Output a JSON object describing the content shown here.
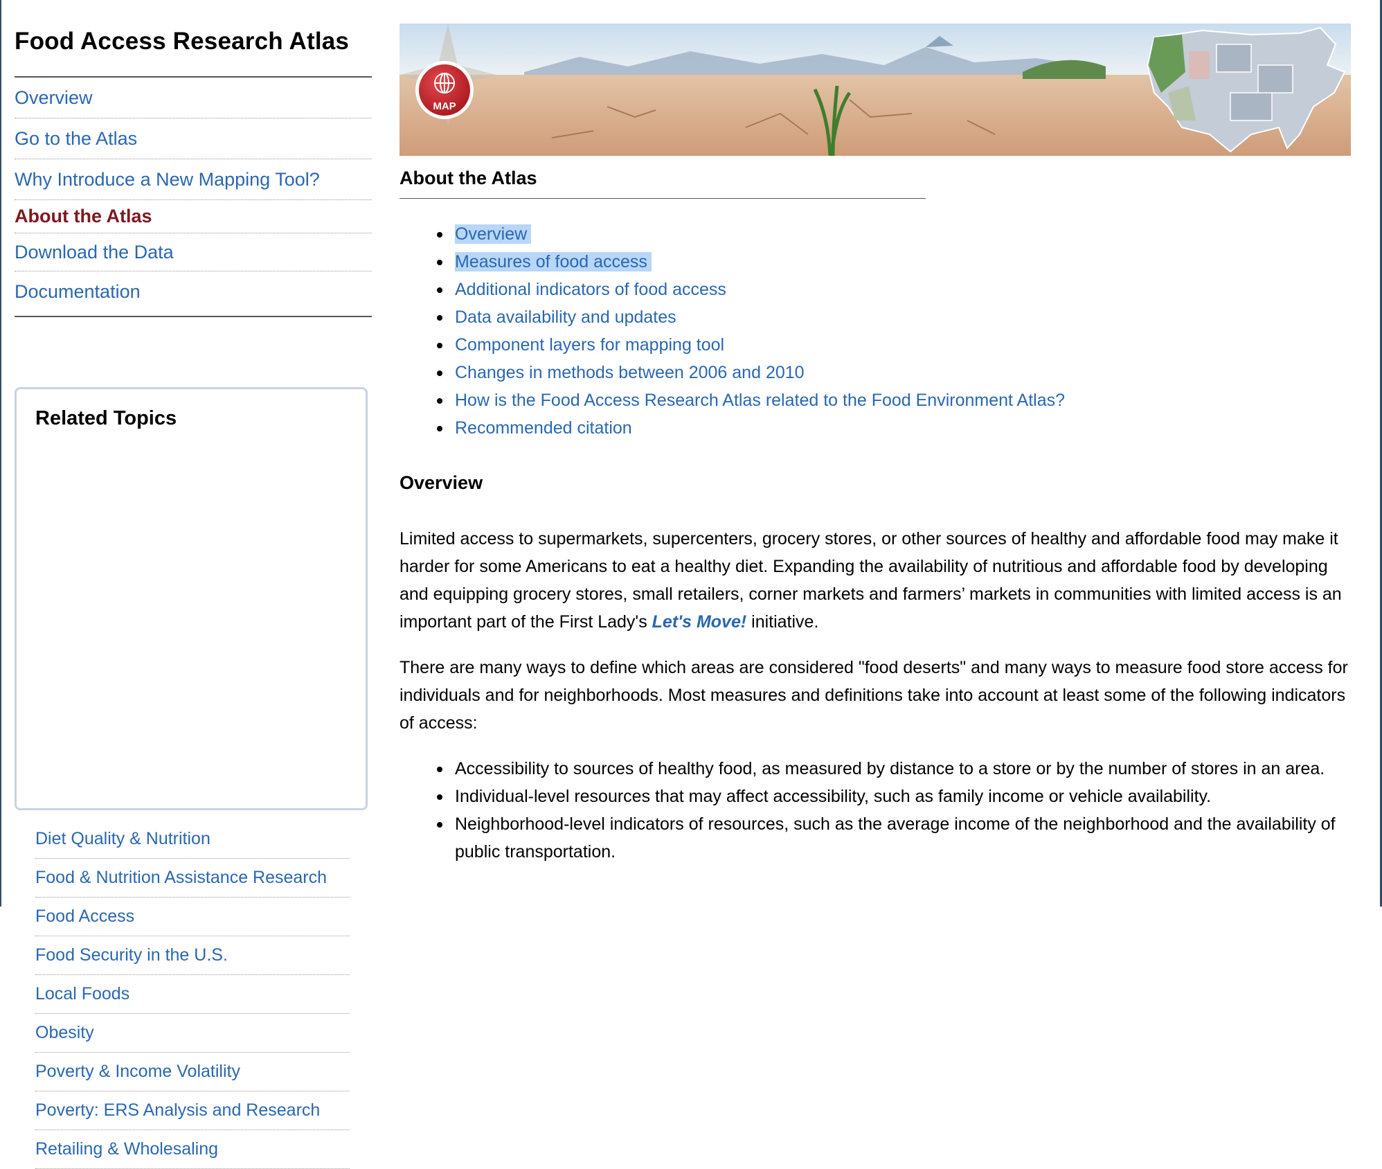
{
  "sidebar": {
    "site_title": "Food Access Research Atlas",
    "nav": [
      {
        "label": "Overview",
        "active": false
      },
      {
        "label": "Go to the Atlas",
        "active": false
      },
      {
        "label": "Why Introduce a New Mapping Tool?",
        "active": false
      },
      {
        "label": "About the Atlas",
        "active": true
      },
      {
        "label": "Download the Data",
        "active": false
      },
      {
        "label": "Documentation",
        "active": false
      }
    ],
    "related": {
      "title": "Related Topics",
      "items": [
        "Diet Quality & Nutrition",
        "Food & Nutrition Assistance Research",
        "Food Access",
        "Food Security in the U.S.",
        "Local Foods",
        "Obesity",
        "Poverty & Income Volatility",
        "Poverty: ERS Analysis and Research",
        "Retailing & Wholesaling"
      ]
    }
  },
  "banner": {
    "badge_label": "MAP"
  },
  "main": {
    "section_title": "About the Atlas",
    "toc": [
      {
        "label": "Overview",
        "highlighted": true
      },
      {
        "label": "Measures of food access",
        "highlighted": true
      },
      {
        "label": "Additional indicators of food access",
        "highlighted": false
      },
      {
        "label": "Data availability and updates",
        "highlighted": false
      },
      {
        "label": "Component layers for mapping tool",
        "highlighted": false
      },
      {
        "label": "Changes in methods between 2006 and 2010",
        "highlighted": false
      },
      {
        "label": "How is the Food Access Research Atlas related to the Food Environment Atlas?",
        "highlighted": false
      },
      {
        "label": "Recommended citation",
        "highlighted": false
      }
    ],
    "overview_title": "Overview",
    "p1_before": "Limited access to supermarkets, supercenters, grocery stores, or other sources of healthy and affordable food may make it harder for some Americans to eat a healthy diet.  Expanding the availability of nutritious and affordable food by developing and equipping grocery stores, small retailers, corner markets and farmers’ markets in communities with limited access is an important part of the First Lady's ",
    "p1_link": "Let's Move!",
    "p1_after": " initiative.",
    "p2": "There are many ways to define which areas are considered \"food deserts\" and many ways to measure food store access for individuals and for neighborhoods. Most measures and definitions take into account at least some of the following indicators of access:",
    "bullets": [
      "Accessibility to sources of healthy food, as measured by distance to a store or by the number of stores in an area.",
      "Individual-level resources that may affect accessibility, such as family income or vehicle availability.",
      "Neighborhood-level indicators of resources, such as the average income of the neighborhood and the availability of public transportation."
    ]
  },
  "colors": {
    "link": "#2a67b1",
    "active_nav": "#7d1a1f",
    "highlight": "#b8d6f7",
    "related_border": "#c8d3e4",
    "badge_red": "#c8282d"
  }
}
